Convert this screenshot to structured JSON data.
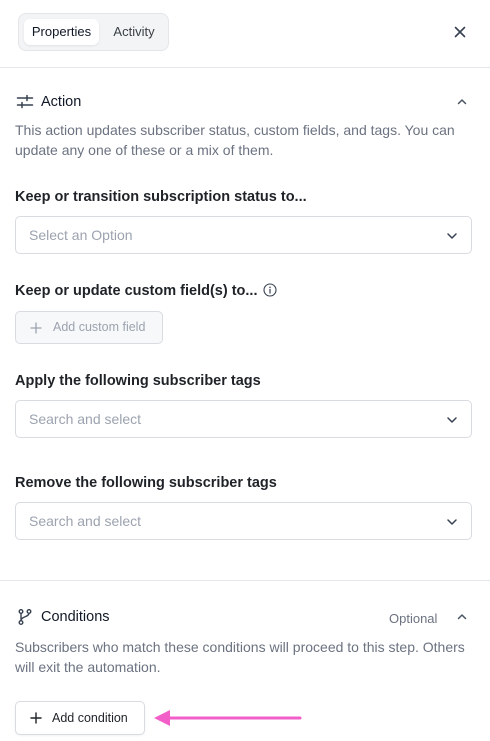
{
  "tabs": [
    {
      "label": "Properties",
      "active": true
    },
    {
      "label": "Activity",
      "active": false
    }
  ],
  "action": {
    "title": "Action",
    "description": "This action updates subscriber status, custom fields, and tags. You can update any one of these or a mix of them.",
    "status": {
      "label": "Keep or transition subscription status to...",
      "placeholder": "Select an Option"
    },
    "custom_fields": {
      "label": "Keep or update custom field(s) to...",
      "button": "Add custom field"
    },
    "apply_tags": {
      "label": "Apply the following subscriber tags",
      "placeholder": "Search and select"
    },
    "remove_tags": {
      "label": "Remove the following subscriber tags",
      "placeholder": "Search and select"
    }
  },
  "conditions": {
    "title": "Conditions",
    "optional": "Optional",
    "description": "Subscribers who match these conditions will proceed to this step. Others will exit the automation.",
    "button": "Add condition"
  },
  "colors": {
    "annotation_arrow": "#f25fc8",
    "border": "#d8dbe0",
    "muted": "#6b7280"
  },
  "icons": {
    "close": "close-icon",
    "action": "sliders-icon",
    "conditions": "git-branch-icon",
    "collapse": "chevron-up-icon",
    "dropdown": "chevron-down-icon",
    "info": "info-icon",
    "add": "plus-icon"
  }
}
